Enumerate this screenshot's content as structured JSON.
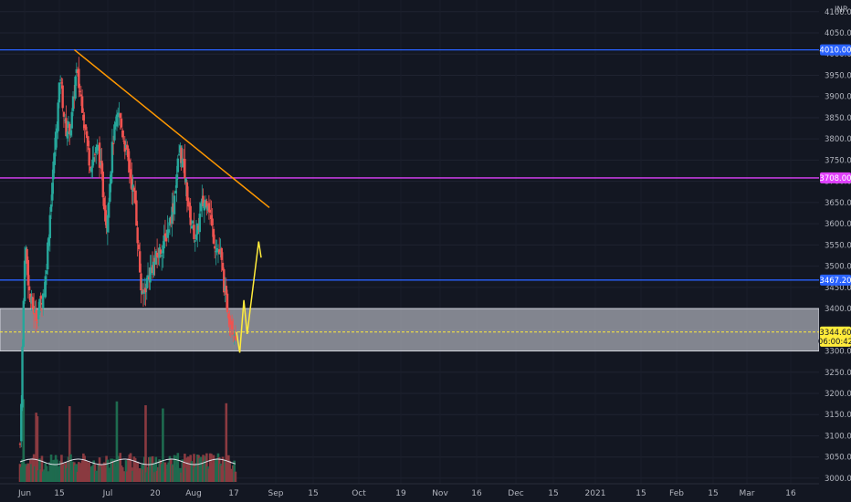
{
  "chart_data": {
    "type": "candlestick",
    "currency_label": "INR",
    "y_axis": {
      "ylim": [
        2985,
        4095
      ],
      "ticks": [
        "4100.00",
        "4050.00",
        "4000.00",
        "3950.00",
        "3900.00",
        "3850.00",
        "3800.00",
        "3750.00",
        "3700.00",
        "3650.00",
        "3600.00",
        "3550.00",
        "3500.00",
        "3450.00",
        "3400.00",
        "3350.00",
        "3300.00",
        "3250.00",
        "3200.00",
        "3150.00",
        "3100.00",
        "3050.00",
        "3000.00"
      ]
    },
    "x_axis": {
      "ticks": [
        "Jun",
        "15",
        "Jul",
        "20",
        "Aug",
        "17",
        "Sep",
        "15",
        "Oct",
        "19",
        "Nov",
        "16",
        "Dec",
        "15",
        "2021",
        "15",
        "Feb",
        "15",
        "Mar",
        "16"
      ]
    },
    "price_labels": [
      {
        "text": "4010.00",
        "value": 4010,
        "bg": "#2962ff",
        "fg": "#ffffff"
      },
      {
        "text": "3708.00",
        "value": 3708,
        "bg": "#e040fb",
        "fg": "#ffffff"
      },
      {
        "text": "3467.20",
        "value": 3467.2,
        "bg": "#2962ff",
        "fg": "#ffffff"
      },
      {
        "text": "3344.60",
        "value": 3344.6,
        "bg": "#ffeb3b",
        "fg": "#131722"
      },
      {
        "text": "06:00:42",
        "value": 3323,
        "bg": "#ffeb3b",
        "fg": "#131722"
      }
    ],
    "horizontal_lines": [
      {
        "name": "resistance",
        "value": 4010,
        "color": "#2962ff"
      },
      {
        "name": "level",
        "value": 3708,
        "color": "#e040fb"
      },
      {
        "name": "support",
        "value": 3467.2,
        "color": "#2962ff"
      },
      {
        "name": "last-price",
        "value": 3344.6,
        "color": "#ffeb3b",
        "dashed": true
      }
    ],
    "support_zone": {
      "from": 3300,
      "to": 3400,
      "color": "#b2b5be"
    },
    "trendline": {
      "from": {
        "date": "Aug 6",
        "value": 4010
      },
      "to": {
        "date": "Mar 31",
        "value": 3638
      },
      "color": "#ff9800"
    },
    "projection_path": {
      "color": "#ffeb3b",
      "points": [
        {
          "date": "Feb 19",
          "value": 3345
        },
        {
          "date": "Feb 23",
          "value": 3296
        },
        {
          "date": "Feb 28",
          "value": 3420
        },
        {
          "date": "Mar 4",
          "value": 3340
        },
        {
          "date": "Mar 18",
          "value": 3558
        },
        {
          "date": "Mar 21",
          "value": 3520
        }
      ]
    },
    "series_summary": {
      "period_high": 4010,
      "period_low": 3050,
      "last_close": 3344.6
    }
  }
}
